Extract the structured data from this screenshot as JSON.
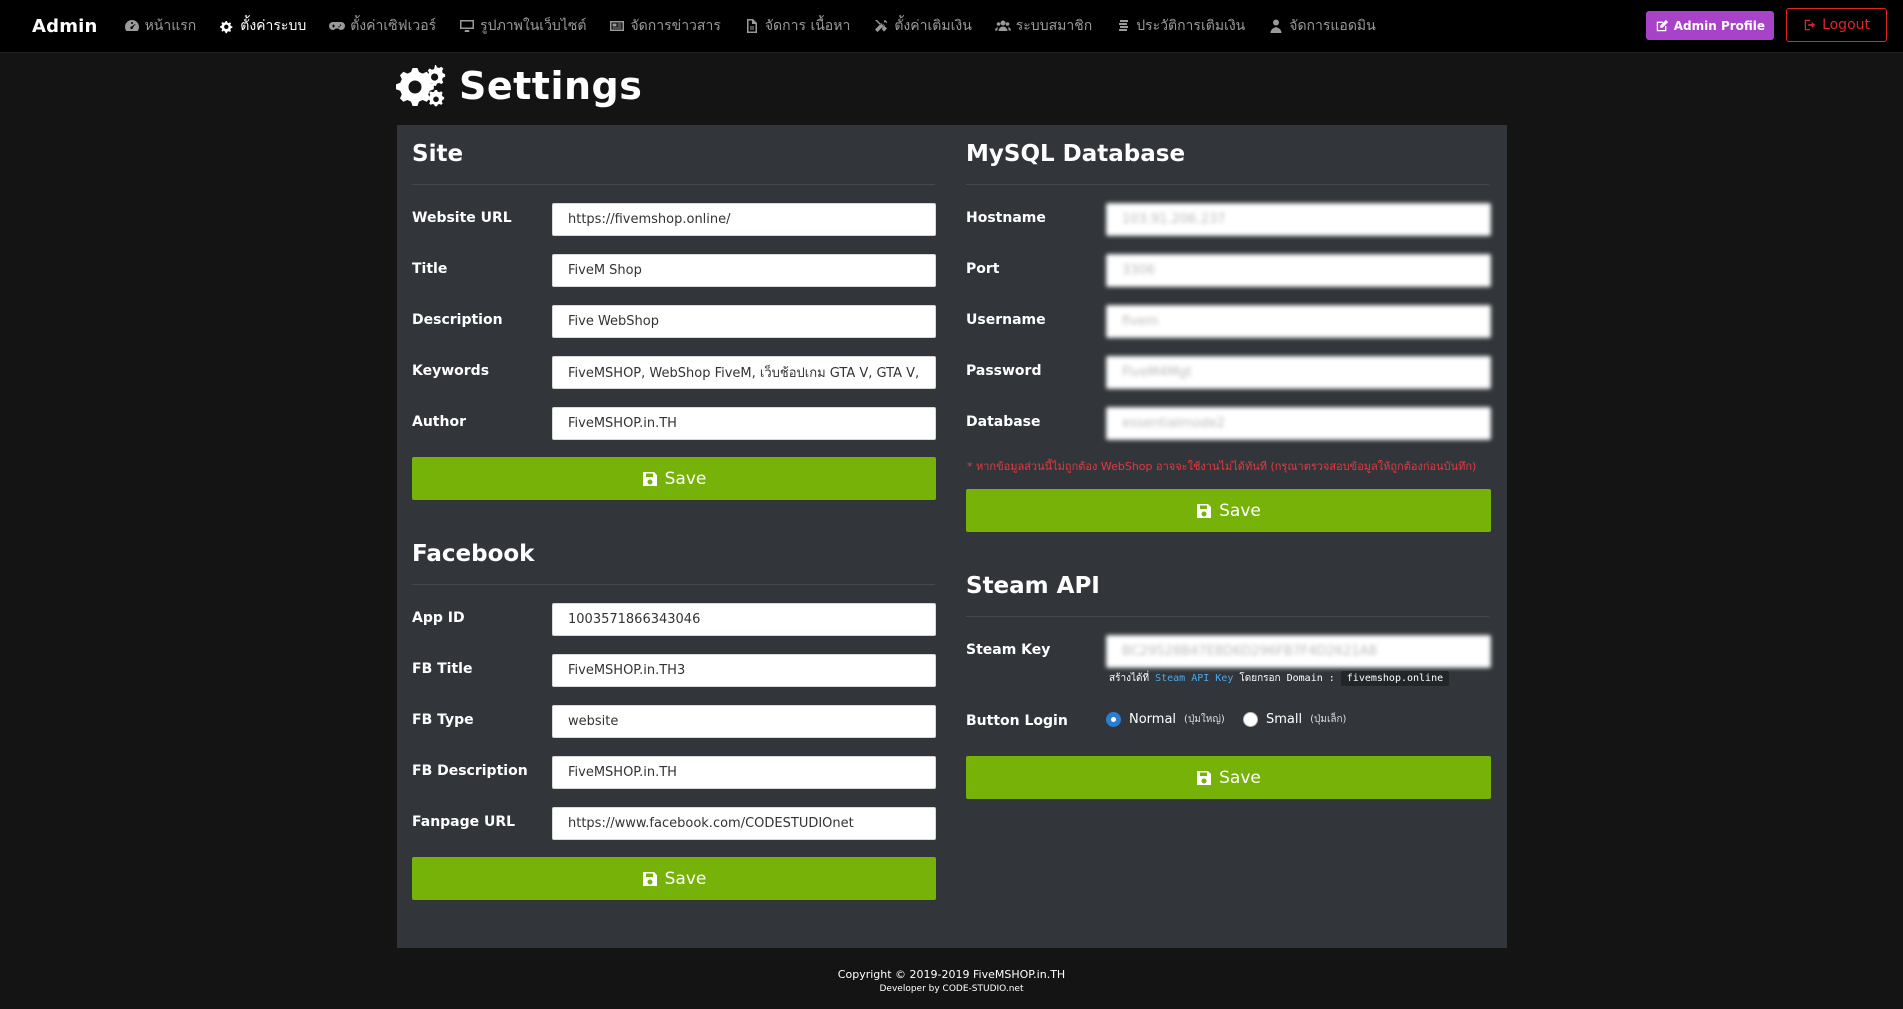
{
  "nav": {
    "brand": "Admin",
    "items": [
      {
        "label": "หน้าแรก",
        "icon": "dashboard-icon",
        "active": false
      },
      {
        "label": "ตั้งค่าระบบ",
        "icon": "cogs-icon",
        "active": true
      },
      {
        "label": "ตั้งค่าเซิฟเวอร์",
        "icon": "gamepad-icon",
        "active": false
      },
      {
        "label": "รูปภาพในเว็บไซต์",
        "icon": "monitor-icon",
        "active": false
      },
      {
        "label": "จัดการข่าวสาร",
        "icon": "newspaper-icon",
        "active": false
      },
      {
        "label": "จัดการ เนื้อหา",
        "icon": "file-icon",
        "active": false
      },
      {
        "label": "ตั้งค่าเติมเงิน",
        "icon": "tools-icon",
        "active": false
      },
      {
        "label": "ระบบสมาชิก",
        "icon": "users-icon",
        "active": false
      },
      {
        "label": "ประวัติการเติมเงิน",
        "icon": "coins-icon",
        "active": false
      },
      {
        "label": "จัดการแอดมิน",
        "icon": "user-tie-icon",
        "active": false
      }
    ],
    "profile_label": "Admin Profile",
    "logout_label": "Logout"
  },
  "page": {
    "title": "Settings"
  },
  "site": {
    "title": "Site",
    "fields": [
      {
        "label": "Website URL",
        "value": "https://fivemshop.online/"
      },
      {
        "label": "Title",
        "value": "FiveM Shop"
      },
      {
        "label": "Description",
        "value": "Five WebShop"
      },
      {
        "label": "Keywords",
        "value": "FiveMSHOP, WebShop FiveM, เว็บช้อปเกม GTA V, GTA V,"
      },
      {
        "label": "Author",
        "value": "FiveMSHOP.in.TH"
      }
    ],
    "save_label": "Save"
  },
  "facebook": {
    "title": "Facebook",
    "fields": [
      {
        "label": "App ID",
        "value": "1003571866343046"
      },
      {
        "label": "FB Title",
        "value": "FiveMSHOP.in.TH3"
      },
      {
        "label": "FB Type",
        "value": "website"
      },
      {
        "label": "FB Description",
        "value": "FiveMSHOP.in.TH"
      },
      {
        "label": "Fanpage URL",
        "value": "https://www.facebook.com/CODESTUDIOnet"
      }
    ],
    "save_label": "Save"
  },
  "mysql": {
    "title": "MySQL Database",
    "fields": [
      {
        "label": "Hostname",
        "value": "103.91.206.237"
      },
      {
        "label": "Port",
        "value": "3306"
      },
      {
        "label": "Username",
        "value": "fivem"
      },
      {
        "label": "Password",
        "value": "FiveM4Mgt"
      },
      {
        "label": "Database",
        "value": "essentialmode2"
      }
    ],
    "warning": "* หากข้อมูลส่วนนี้ไม่ถูกต้อง WebShop อาจจะใช้งานไม่ได้ทันที (กรุณาตรวจสอบข้อมูลให้ถูกต้องก่อนบันทึก)",
    "save_label": "Save"
  },
  "steam": {
    "title": "Steam API",
    "key_label": "Steam Key",
    "key_value": "BC29528B47E8D6D296FB7F4D2621A8",
    "hint_prefix": "สร้างได้ที่",
    "hint_link": "Steam API Key",
    "hint_mid": "โดยกรอก Domain :",
    "hint_domain": "fivemshop.online",
    "login_label": "Button Login",
    "options": [
      {
        "label": "Normal",
        "sub": "(ปุ่มใหญ่)",
        "checked": true
      },
      {
        "label": "Small",
        "sub": "(ปุ่มเล็ก)",
        "checked": false
      }
    ],
    "save_label": "Save"
  },
  "footer": {
    "copyright": "Copyright © 2019-2019 FiveMSHOP.in.TH",
    "developer": "Developer by CODE-STUDIO.net"
  },
  "colors": {
    "accent_green": "#76b207",
    "profile_purple": "#a742c9",
    "logout_red": "#e02424",
    "panel_bg": "#32363b"
  }
}
